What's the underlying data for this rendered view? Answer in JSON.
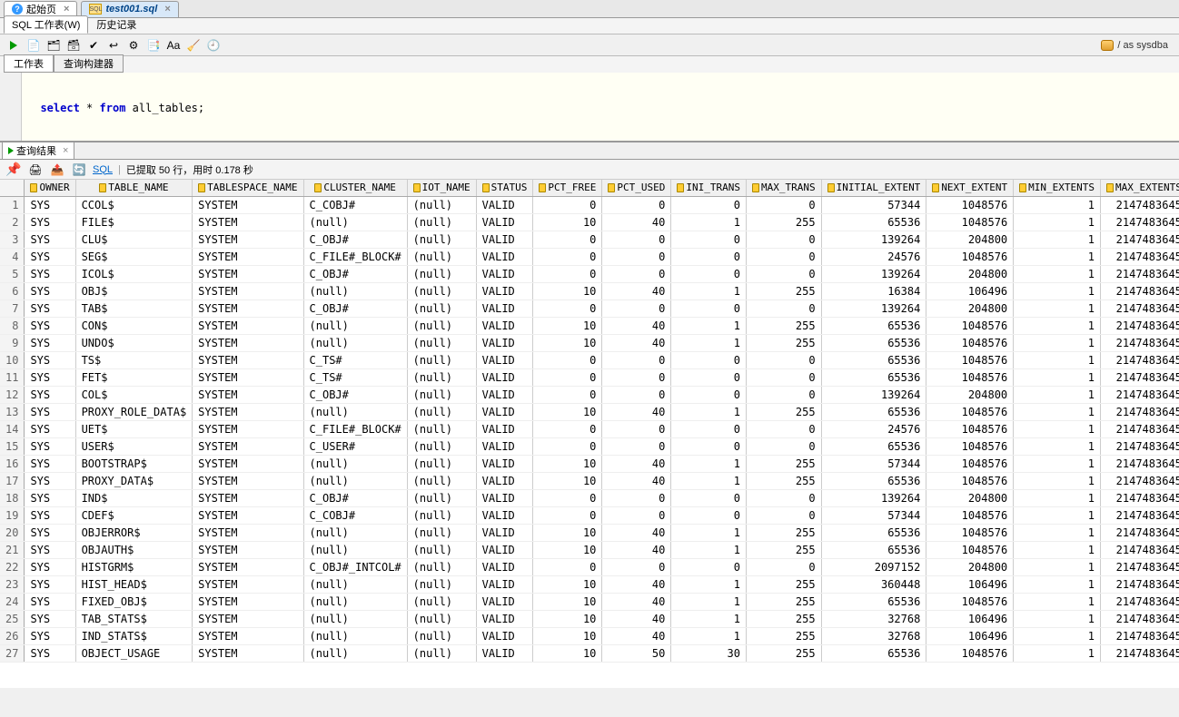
{
  "tabs": {
    "start": "起始页",
    "file": "test001.sql"
  },
  "subtabs": {
    "worksheet": "SQL 工作表(W)",
    "history": "历史记录"
  },
  "conn": "/ as sysdba",
  "editor_tabs": {
    "worksheet": "工作表",
    "builder": "查询构建器"
  },
  "sql": {
    "kw1": "select",
    "star": "*",
    "kw2": "from",
    "ident": "all_tables;"
  },
  "result_tabs": {
    "result": "查询结果"
  },
  "rtoolbar": {
    "sql_link": "SQL",
    "status_prefix": "已提取 50 行，用时 0.178 秒"
  },
  "columns": [
    "OWNER",
    "TABLE_NAME",
    "TABLESPACE_NAME",
    "CLUSTER_NAME",
    "IOT_NAME",
    "STATUS",
    "PCT_FREE",
    "PCT_USED",
    "INI_TRANS",
    "MAX_TRANS",
    "INITIAL_EXTENT",
    "NEXT_EXTENT",
    "MIN_EXTENTS",
    "MAX_EXTENTS"
  ],
  "rows": [
    {
      "n": 1,
      "OWNER": "SYS",
      "TABLE_NAME": "CCOL$",
      "TABLESPACE_NAME": "SYSTEM",
      "CLUSTER_NAME": "C_COBJ#",
      "IOT_NAME": "(null)",
      "STATUS": "VALID",
      "PCT_FREE": 0,
      "PCT_USED": 0,
      "INI_TRANS": 0,
      "MAX_TRANS": 0,
      "INITIAL_EXTENT": 57344,
      "NEXT_EXTENT": 1048576,
      "MIN_EXTENTS": 1,
      "MAX_EXTENTS": 2147483645
    },
    {
      "n": 2,
      "OWNER": "SYS",
      "TABLE_NAME": "FILE$",
      "TABLESPACE_NAME": "SYSTEM",
      "CLUSTER_NAME": "(null)",
      "IOT_NAME": "(null)",
      "STATUS": "VALID",
      "PCT_FREE": 10,
      "PCT_USED": 40,
      "INI_TRANS": 1,
      "MAX_TRANS": 255,
      "INITIAL_EXTENT": 65536,
      "NEXT_EXTENT": 1048576,
      "MIN_EXTENTS": 1,
      "MAX_EXTENTS": 2147483645
    },
    {
      "n": 3,
      "OWNER": "SYS",
      "TABLE_NAME": "CLU$",
      "TABLESPACE_NAME": "SYSTEM",
      "CLUSTER_NAME": "C_OBJ#",
      "IOT_NAME": "(null)",
      "STATUS": "VALID",
      "PCT_FREE": 0,
      "PCT_USED": 0,
      "INI_TRANS": 0,
      "MAX_TRANS": 0,
      "INITIAL_EXTENT": 139264,
      "NEXT_EXTENT": 204800,
      "MIN_EXTENTS": 1,
      "MAX_EXTENTS": 2147483645
    },
    {
      "n": 4,
      "OWNER": "SYS",
      "TABLE_NAME": "SEG$",
      "TABLESPACE_NAME": "SYSTEM",
      "CLUSTER_NAME": "C_FILE#_BLOCK#",
      "IOT_NAME": "(null)",
      "STATUS": "VALID",
      "PCT_FREE": 0,
      "PCT_USED": 0,
      "INI_TRANS": 0,
      "MAX_TRANS": 0,
      "INITIAL_EXTENT": 24576,
      "NEXT_EXTENT": 1048576,
      "MIN_EXTENTS": 1,
      "MAX_EXTENTS": 2147483645
    },
    {
      "n": 5,
      "OWNER": "SYS",
      "TABLE_NAME": "ICOL$",
      "TABLESPACE_NAME": "SYSTEM",
      "CLUSTER_NAME": "C_OBJ#",
      "IOT_NAME": "(null)",
      "STATUS": "VALID",
      "PCT_FREE": 0,
      "PCT_USED": 0,
      "INI_TRANS": 0,
      "MAX_TRANS": 0,
      "INITIAL_EXTENT": 139264,
      "NEXT_EXTENT": 204800,
      "MIN_EXTENTS": 1,
      "MAX_EXTENTS": 2147483645
    },
    {
      "n": 6,
      "OWNER": "SYS",
      "TABLE_NAME": "OBJ$",
      "TABLESPACE_NAME": "SYSTEM",
      "CLUSTER_NAME": "(null)",
      "IOT_NAME": "(null)",
      "STATUS": "VALID",
      "PCT_FREE": 10,
      "PCT_USED": 40,
      "INI_TRANS": 1,
      "MAX_TRANS": 255,
      "INITIAL_EXTENT": 16384,
      "NEXT_EXTENT": 106496,
      "MIN_EXTENTS": 1,
      "MAX_EXTENTS": 2147483645
    },
    {
      "n": 7,
      "OWNER": "SYS",
      "TABLE_NAME": "TAB$",
      "TABLESPACE_NAME": "SYSTEM",
      "CLUSTER_NAME": "C_OBJ#",
      "IOT_NAME": "(null)",
      "STATUS": "VALID",
      "PCT_FREE": 0,
      "PCT_USED": 0,
      "INI_TRANS": 0,
      "MAX_TRANS": 0,
      "INITIAL_EXTENT": 139264,
      "NEXT_EXTENT": 204800,
      "MIN_EXTENTS": 1,
      "MAX_EXTENTS": 2147483645
    },
    {
      "n": 8,
      "OWNER": "SYS",
      "TABLE_NAME": "CON$",
      "TABLESPACE_NAME": "SYSTEM",
      "CLUSTER_NAME": "(null)",
      "IOT_NAME": "(null)",
      "STATUS": "VALID",
      "PCT_FREE": 10,
      "PCT_USED": 40,
      "INI_TRANS": 1,
      "MAX_TRANS": 255,
      "INITIAL_EXTENT": 65536,
      "NEXT_EXTENT": 1048576,
      "MIN_EXTENTS": 1,
      "MAX_EXTENTS": 2147483645
    },
    {
      "n": 9,
      "OWNER": "SYS",
      "TABLE_NAME": "UNDO$",
      "TABLESPACE_NAME": "SYSTEM",
      "CLUSTER_NAME": "(null)",
      "IOT_NAME": "(null)",
      "STATUS": "VALID",
      "PCT_FREE": 10,
      "PCT_USED": 40,
      "INI_TRANS": 1,
      "MAX_TRANS": 255,
      "INITIAL_EXTENT": 65536,
      "NEXT_EXTENT": 1048576,
      "MIN_EXTENTS": 1,
      "MAX_EXTENTS": 2147483645
    },
    {
      "n": 10,
      "OWNER": "SYS",
      "TABLE_NAME": "TS$",
      "TABLESPACE_NAME": "SYSTEM",
      "CLUSTER_NAME": "C_TS#",
      "IOT_NAME": "(null)",
      "STATUS": "VALID",
      "PCT_FREE": 0,
      "PCT_USED": 0,
      "INI_TRANS": 0,
      "MAX_TRANS": 0,
      "INITIAL_EXTENT": 65536,
      "NEXT_EXTENT": 1048576,
      "MIN_EXTENTS": 1,
      "MAX_EXTENTS": 2147483645
    },
    {
      "n": 11,
      "OWNER": "SYS",
      "TABLE_NAME": "FET$",
      "TABLESPACE_NAME": "SYSTEM",
      "CLUSTER_NAME": "C_TS#",
      "IOT_NAME": "(null)",
      "STATUS": "VALID",
      "PCT_FREE": 0,
      "PCT_USED": 0,
      "INI_TRANS": 0,
      "MAX_TRANS": 0,
      "INITIAL_EXTENT": 65536,
      "NEXT_EXTENT": 1048576,
      "MIN_EXTENTS": 1,
      "MAX_EXTENTS": 2147483645
    },
    {
      "n": 12,
      "OWNER": "SYS",
      "TABLE_NAME": "COL$",
      "TABLESPACE_NAME": "SYSTEM",
      "CLUSTER_NAME": "C_OBJ#",
      "IOT_NAME": "(null)",
      "STATUS": "VALID",
      "PCT_FREE": 0,
      "PCT_USED": 0,
      "INI_TRANS": 0,
      "MAX_TRANS": 0,
      "INITIAL_EXTENT": 139264,
      "NEXT_EXTENT": 204800,
      "MIN_EXTENTS": 1,
      "MAX_EXTENTS": 2147483645
    },
    {
      "n": 13,
      "OWNER": "SYS",
      "TABLE_NAME": "PROXY_ROLE_DATA$",
      "TABLESPACE_NAME": "SYSTEM",
      "CLUSTER_NAME": "(null)",
      "IOT_NAME": "(null)",
      "STATUS": "VALID",
      "PCT_FREE": 10,
      "PCT_USED": 40,
      "INI_TRANS": 1,
      "MAX_TRANS": 255,
      "INITIAL_EXTENT": 65536,
      "NEXT_EXTENT": 1048576,
      "MIN_EXTENTS": 1,
      "MAX_EXTENTS": 2147483645
    },
    {
      "n": 14,
      "OWNER": "SYS",
      "TABLE_NAME": "UET$",
      "TABLESPACE_NAME": "SYSTEM",
      "CLUSTER_NAME": "C_FILE#_BLOCK#",
      "IOT_NAME": "(null)",
      "STATUS": "VALID",
      "PCT_FREE": 0,
      "PCT_USED": 0,
      "INI_TRANS": 0,
      "MAX_TRANS": 0,
      "INITIAL_EXTENT": 24576,
      "NEXT_EXTENT": 1048576,
      "MIN_EXTENTS": 1,
      "MAX_EXTENTS": 2147483645
    },
    {
      "n": 15,
      "OWNER": "SYS",
      "TABLE_NAME": "USER$",
      "TABLESPACE_NAME": "SYSTEM",
      "CLUSTER_NAME": "C_USER#",
      "IOT_NAME": "(null)",
      "STATUS": "VALID",
      "PCT_FREE": 0,
      "PCT_USED": 0,
      "INI_TRANS": 0,
      "MAX_TRANS": 0,
      "INITIAL_EXTENT": 65536,
      "NEXT_EXTENT": 1048576,
      "MIN_EXTENTS": 1,
      "MAX_EXTENTS": 2147483645
    },
    {
      "n": 16,
      "OWNER": "SYS",
      "TABLE_NAME": "BOOTSTRAP$",
      "TABLESPACE_NAME": "SYSTEM",
      "CLUSTER_NAME": "(null)",
      "IOT_NAME": "(null)",
      "STATUS": "VALID",
      "PCT_FREE": 10,
      "PCT_USED": 40,
      "INI_TRANS": 1,
      "MAX_TRANS": 255,
      "INITIAL_EXTENT": 57344,
      "NEXT_EXTENT": 1048576,
      "MIN_EXTENTS": 1,
      "MAX_EXTENTS": 2147483645
    },
    {
      "n": 17,
      "OWNER": "SYS",
      "TABLE_NAME": "PROXY_DATA$",
      "TABLESPACE_NAME": "SYSTEM",
      "CLUSTER_NAME": "(null)",
      "IOT_NAME": "(null)",
      "STATUS": "VALID",
      "PCT_FREE": 10,
      "PCT_USED": 40,
      "INI_TRANS": 1,
      "MAX_TRANS": 255,
      "INITIAL_EXTENT": 65536,
      "NEXT_EXTENT": 1048576,
      "MIN_EXTENTS": 1,
      "MAX_EXTENTS": 2147483645
    },
    {
      "n": 18,
      "OWNER": "SYS",
      "TABLE_NAME": "IND$",
      "TABLESPACE_NAME": "SYSTEM",
      "CLUSTER_NAME": "C_OBJ#",
      "IOT_NAME": "(null)",
      "STATUS": "VALID",
      "PCT_FREE": 0,
      "PCT_USED": 0,
      "INI_TRANS": 0,
      "MAX_TRANS": 0,
      "INITIAL_EXTENT": 139264,
      "NEXT_EXTENT": 204800,
      "MIN_EXTENTS": 1,
      "MAX_EXTENTS": 2147483645
    },
    {
      "n": 19,
      "OWNER": "SYS",
      "TABLE_NAME": "CDEF$",
      "TABLESPACE_NAME": "SYSTEM",
      "CLUSTER_NAME": "C_COBJ#",
      "IOT_NAME": "(null)",
      "STATUS": "VALID",
      "PCT_FREE": 0,
      "PCT_USED": 0,
      "INI_TRANS": 0,
      "MAX_TRANS": 0,
      "INITIAL_EXTENT": 57344,
      "NEXT_EXTENT": 1048576,
      "MIN_EXTENTS": 1,
      "MAX_EXTENTS": 2147483645
    },
    {
      "n": 20,
      "OWNER": "SYS",
      "TABLE_NAME": "OBJERROR$",
      "TABLESPACE_NAME": "SYSTEM",
      "CLUSTER_NAME": "(null)",
      "IOT_NAME": "(null)",
      "STATUS": "VALID",
      "PCT_FREE": 10,
      "PCT_USED": 40,
      "INI_TRANS": 1,
      "MAX_TRANS": 255,
      "INITIAL_EXTENT": 65536,
      "NEXT_EXTENT": 1048576,
      "MIN_EXTENTS": 1,
      "MAX_EXTENTS": 2147483645
    },
    {
      "n": 21,
      "OWNER": "SYS",
      "TABLE_NAME": "OBJAUTH$",
      "TABLESPACE_NAME": "SYSTEM",
      "CLUSTER_NAME": "(null)",
      "IOT_NAME": "(null)",
      "STATUS": "VALID",
      "PCT_FREE": 10,
      "PCT_USED": 40,
      "INI_TRANS": 1,
      "MAX_TRANS": 255,
      "INITIAL_EXTENT": 65536,
      "NEXT_EXTENT": 1048576,
      "MIN_EXTENTS": 1,
      "MAX_EXTENTS": 2147483645
    },
    {
      "n": 22,
      "OWNER": "SYS",
      "TABLE_NAME": "HISTGRM$",
      "TABLESPACE_NAME": "SYSTEM",
      "CLUSTER_NAME": "C_OBJ#_INTCOL#",
      "IOT_NAME": "(null)",
      "STATUS": "VALID",
      "PCT_FREE": 0,
      "PCT_USED": 0,
      "INI_TRANS": 0,
      "MAX_TRANS": 0,
      "INITIAL_EXTENT": 2097152,
      "NEXT_EXTENT": 204800,
      "MIN_EXTENTS": 1,
      "MAX_EXTENTS": 2147483645
    },
    {
      "n": 23,
      "OWNER": "SYS",
      "TABLE_NAME": "HIST_HEAD$",
      "TABLESPACE_NAME": "SYSTEM",
      "CLUSTER_NAME": "(null)",
      "IOT_NAME": "(null)",
      "STATUS": "VALID",
      "PCT_FREE": 10,
      "PCT_USED": 40,
      "INI_TRANS": 1,
      "MAX_TRANS": 255,
      "INITIAL_EXTENT": 360448,
      "NEXT_EXTENT": 106496,
      "MIN_EXTENTS": 1,
      "MAX_EXTENTS": 2147483645
    },
    {
      "n": 24,
      "OWNER": "SYS",
      "TABLE_NAME": "FIXED_OBJ$",
      "TABLESPACE_NAME": "SYSTEM",
      "CLUSTER_NAME": "(null)",
      "IOT_NAME": "(null)",
      "STATUS": "VALID",
      "PCT_FREE": 10,
      "PCT_USED": 40,
      "INI_TRANS": 1,
      "MAX_TRANS": 255,
      "INITIAL_EXTENT": 65536,
      "NEXT_EXTENT": 1048576,
      "MIN_EXTENTS": 1,
      "MAX_EXTENTS": 2147483645
    },
    {
      "n": 25,
      "OWNER": "SYS",
      "TABLE_NAME": "TAB_STATS$",
      "TABLESPACE_NAME": "SYSTEM",
      "CLUSTER_NAME": "(null)",
      "IOT_NAME": "(null)",
      "STATUS": "VALID",
      "PCT_FREE": 10,
      "PCT_USED": 40,
      "INI_TRANS": 1,
      "MAX_TRANS": 255,
      "INITIAL_EXTENT": 32768,
      "NEXT_EXTENT": 106496,
      "MIN_EXTENTS": 1,
      "MAX_EXTENTS": 2147483645
    },
    {
      "n": 26,
      "OWNER": "SYS",
      "TABLE_NAME": "IND_STATS$",
      "TABLESPACE_NAME": "SYSTEM",
      "CLUSTER_NAME": "(null)",
      "IOT_NAME": "(null)",
      "STATUS": "VALID",
      "PCT_FREE": 10,
      "PCT_USED": 40,
      "INI_TRANS": 1,
      "MAX_TRANS": 255,
      "INITIAL_EXTENT": 32768,
      "NEXT_EXTENT": 106496,
      "MIN_EXTENTS": 1,
      "MAX_EXTENTS": 2147483645
    },
    {
      "n": 27,
      "OWNER": "SYS",
      "TABLE_NAME": "OBJECT_USAGE",
      "TABLESPACE_NAME": "SYSTEM",
      "CLUSTER_NAME": "(null)",
      "IOT_NAME": "(null)",
      "STATUS": "VALID",
      "PCT_FREE": 10,
      "PCT_USED": 50,
      "INI_TRANS": 30,
      "MAX_TRANS": 255,
      "INITIAL_EXTENT": 65536,
      "NEXT_EXTENT": 1048576,
      "MIN_EXTENTS": 1,
      "MAX_EXTENTS": 2147483645
    }
  ],
  "numeric_cols": [
    "PCT_FREE",
    "PCT_USED",
    "INI_TRANS",
    "MAX_TRANS",
    "INITIAL_EXTENT",
    "NEXT_EXTENT",
    "MIN_EXTENTS",
    "MAX_EXTENTS"
  ]
}
